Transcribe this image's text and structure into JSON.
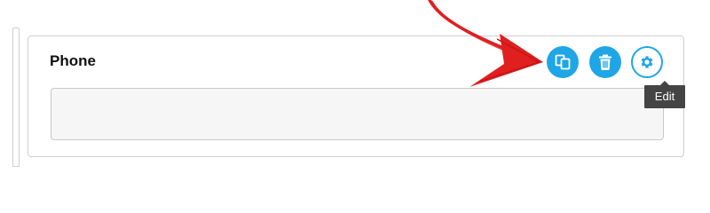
{
  "field": {
    "label": "Phone",
    "input_value": ""
  },
  "actions": {
    "duplicate_icon": "duplicate-icon",
    "delete_icon": "trash-icon",
    "settings_icon": "gear-icon"
  },
  "tooltip": {
    "text": "Edit"
  },
  "colors": {
    "accent": "#1ea6e6",
    "tooltip_bg": "#444444",
    "arrow": "#e01f1f"
  }
}
